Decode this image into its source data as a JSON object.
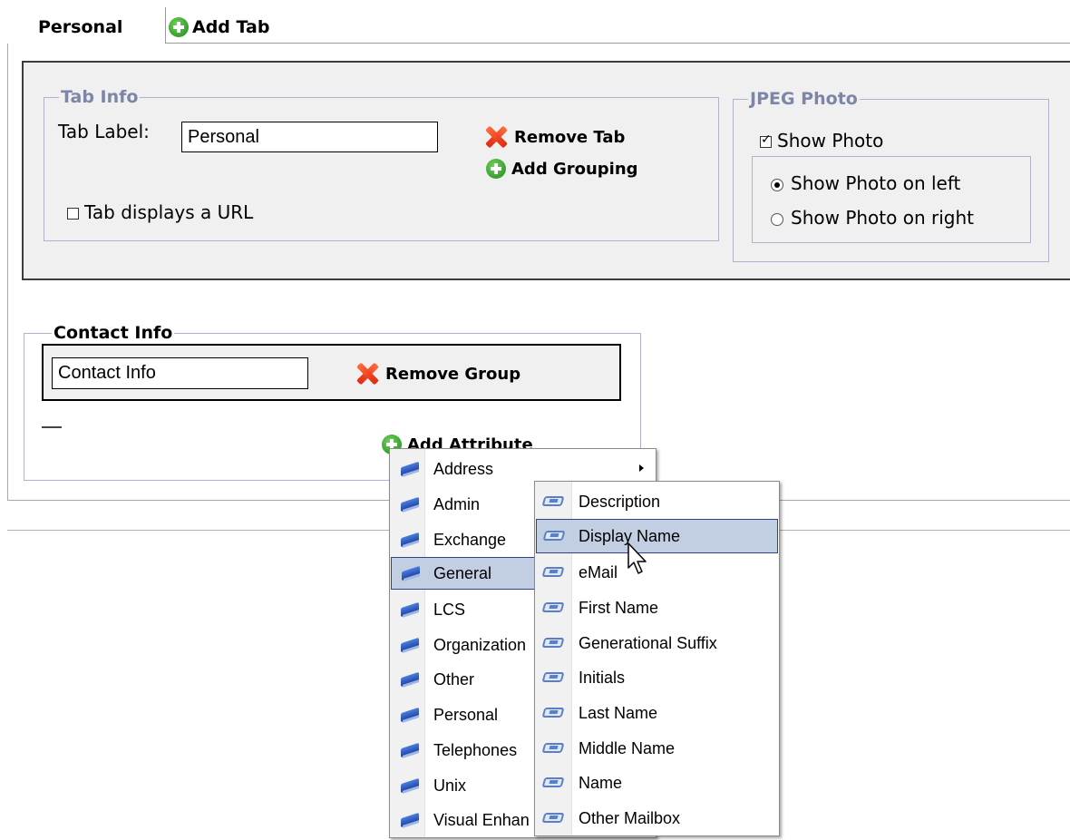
{
  "tabs": {
    "active_label": "Personal",
    "add_label": "Add Tab"
  },
  "tab_info": {
    "legend": "Tab Info",
    "label_text": "Tab Label:",
    "label_value": "Personal",
    "remove_tab": "Remove Tab",
    "add_grouping": "Add Grouping",
    "url_checkbox_label": "Tab displays a URL",
    "url_checked": false
  },
  "jpeg_photo": {
    "legend": "JPEG Photo",
    "show_photo_label": "Show Photo",
    "show_photo_checked": true,
    "left_label": "Show Photo on left",
    "right_label": "Show Photo on right",
    "selected_position": "left"
  },
  "contact_group": {
    "legend": "Contact Info",
    "name_value": "Contact Info",
    "remove_group": "Remove Group",
    "add_attribute": "Add Attribute"
  },
  "category_menu": {
    "items": [
      "Address",
      "Admin",
      "Exchange",
      "General",
      "LCS",
      "Organization",
      "Other",
      "Personal",
      "Telephones",
      "Unix",
      "Visual Enhan"
    ],
    "highlighted": "General",
    "with_submenu": "Address"
  },
  "attribute_menu": {
    "items": [
      "Description",
      "Display Name",
      "eMail",
      "First Name",
      "Generational Suffix",
      "Initials",
      "Last Name",
      "Middle Name",
      "Name",
      "Other Mailbox"
    ],
    "highlighted": "Display Name"
  },
  "icons": {
    "add": "green-plus-icon",
    "remove": "red-x-icon",
    "category": "book-icon",
    "attribute": "attribute-card-icon",
    "cursor": "mouse-pointer-icon"
  },
  "colors": {
    "panel_bg": "#f0f0f0",
    "legend_text": "#7d86a6",
    "fieldset_border": "#b3b0cc",
    "menu_highlight": "#c2cfe3",
    "menu_highlight_border": "#31408a"
  }
}
